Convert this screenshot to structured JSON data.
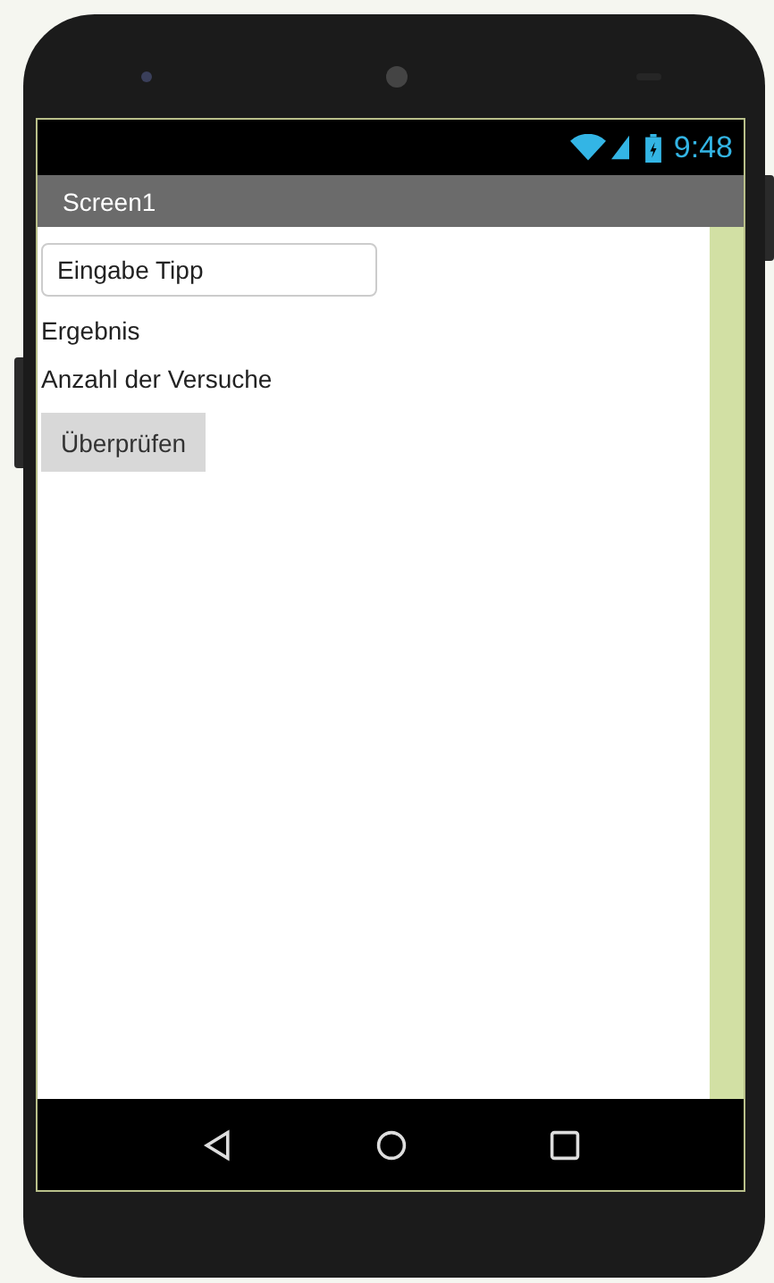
{
  "status_bar": {
    "time": "9:48"
  },
  "title_bar": {
    "title": "Screen1"
  },
  "components": [
    {
      "kind": "textbox",
      "value": "Eingabe Tipp"
    },
    {
      "kind": "label",
      "text": "Ergebnis"
    },
    {
      "kind": "label",
      "text": "Anzahl der Versuche"
    },
    {
      "kind": "button",
      "text": "Überprüfen"
    }
  ]
}
